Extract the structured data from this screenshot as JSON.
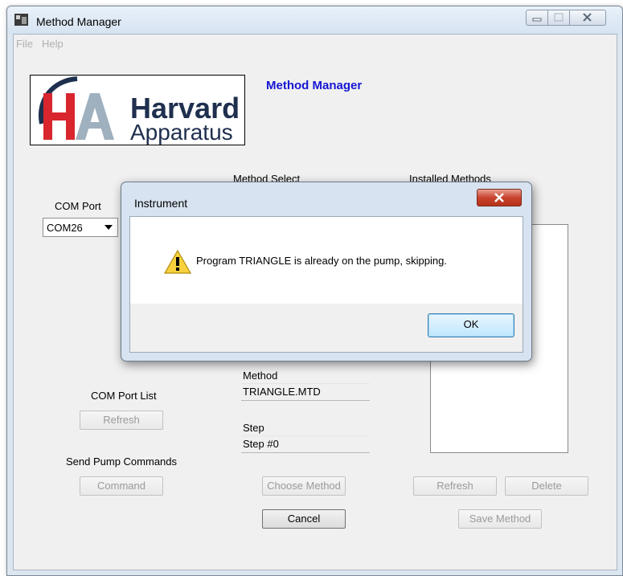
{
  "window": {
    "title": "Method Manager"
  },
  "menu": {
    "items": [
      "File",
      "Help"
    ]
  },
  "logo": {
    "line1": "Harvard",
    "line2": "Apparatus",
    "monogram": "HA"
  },
  "heading": "Method Manager",
  "labels": {
    "method_select": "Method Select",
    "installed_methods": "Installed Methods",
    "com_port": "COM Port",
    "com_port_list": "COM Port List",
    "send_pump_commands": "Send Pump Commands",
    "method": "Method",
    "step": "Step"
  },
  "com_port": {
    "selected": "COM26"
  },
  "fields": {
    "method": "TRIANGLE.MTD",
    "step": "Step #0"
  },
  "buttons": {
    "refresh_com": "Refresh",
    "command": "Command",
    "choose_method": "Choose Method",
    "cancel": "Cancel",
    "refresh_installed": "Refresh",
    "delete": "Delete",
    "save_method": "Save Method"
  },
  "dialog": {
    "title": "Instrument",
    "message": "Program TRIANGLE is already on the pump, skipping.",
    "ok": "OK"
  },
  "colors": {
    "heading": "#1616d4",
    "logo_red": "#d9262e",
    "logo_navy": "#1f2f4e"
  },
  "icons": [
    "app-icon",
    "warning-icon",
    "close-icon",
    "minimize-icon",
    "maximize-icon",
    "dropdown-arrow-icon"
  ]
}
